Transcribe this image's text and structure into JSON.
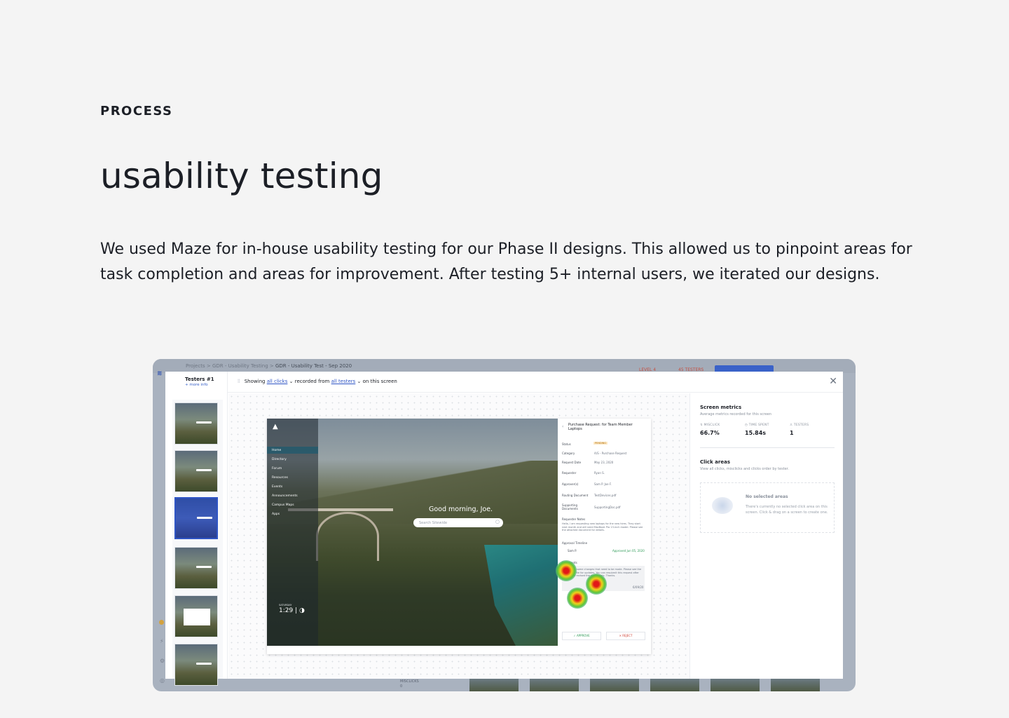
{
  "section_label": "PROCESS",
  "title": "usability testing",
  "intro": "We used Maze for in-house usability testing for our Phase II designs. This allowed us to pinpoint areas for task completion and areas for improvement. After testing 5+ internal users, we iterated our designs.",
  "screenshot": {
    "background": {
      "breadcrumb": [
        "Projects",
        "GDR - Usability Testing",
        "GDR - Usability Test - Sep 2020"
      ],
      "level": "LEVEL 4",
      "testers": "45 TESTERS",
      "bottom_label": "MISCLICKS",
      "bottom_value": "0"
    },
    "left": {
      "tester_title": "Testers #1",
      "more_info": "+ more info"
    },
    "toolbar": {
      "showing": "Showing",
      "clicks_link": "all clicks",
      "recorded_from": "recorded from",
      "testers_link": "all testers",
      "suffix": "on this screen"
    },
    "device": {
      "nav": [
        "Home",
        "Directory",
        "Forum",
        "Resources",
        "Events",
        "Announcements",
        "Campus Maps",
        "Apps"
      ],
      "greeting": "Good morning, Joe.",
      "search_placeholder": "Search Sitewide",
      "clock_caption": "SATURDAY",
      "clock": "1:29"
    },
    "panel": {
      "heading": "Purchase Request: for Team Member Laptops",
      "rows": [
        {
          "label": "Status",
          "value": "PENDING"
        },
        {
          "label": "Category",
          "value": "A/S - Purchase Request"
        },
        {
          "label": "Request Date",
          "value": "May 23, 2020"
        },
        {
          "label": "Requester",
          "value": "Ryan S."
        },
        {
          "label": "Approver(s)",
          "value": "Sam P.   Joe F."
        },
        {
          "label": "Routing Document",
          "value": "TestDevices.pdf"
        },
        {
          "label": "Supporting Documents",
          "value": "SupportingDoc.pdf"
        }
      ],
      "notes_label": "Requester Notes",
      "notes": "Hello, I am requesting new laptops for the new hires. They start next month and will need MacBook Pro 13-inch model. Please see the attached document for details.",
      "timeline_label": "Approval Timeline",
      "timeline_person": "Sam P.",
      "timeline_status": "Approved Jun 05, 2020",
      "comments_label": "Comments",
      "comment": "There are some changes that need to be made. Please see the attached file for updates. You can resubmit this request after you have revised the documents. Thanks.",
      "comment_meta": "6/09/20",
      "approve": "APPROVE",
      "reject": "REJECT"
    },
    "metrics": {
      "title": "Screen metrics",
      "subtitle": "Average metrics recorded for this screen",
      "items": [
        {
          "label": "MISCLICK",
          "value": "66.7%"
        },
        {
          "label": "TIME SPENT",
          "value": "15.84s"
        },
        {
          "label": "TESTERS",
          "value": "1"
        }
      ],
      "click_title": "Click areas",
      "click_sub": "View all clicks, misclicks and clicks order by tester.",
      "empty_title": "No selected areas",
      "empty_text": "There's currently no selected click area on this screen. Click & drag on a screen to create one."
    }
  }
}
